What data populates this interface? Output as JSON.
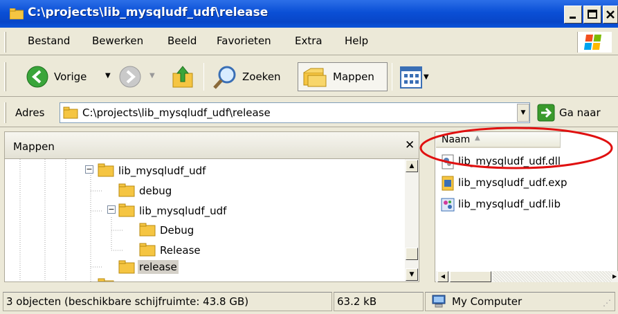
{
  "window": {
    "title": "C:\\projects\\lib_mysqludf_udf\\release"
  },
  "menu": [
    "Bestand",
    "Bewerken",
    "Beeld",
    "Favorieten",
    "Extra",
    "Help"
  ],
  "toolbar": {
    "back": "Vorige",
    "search": "Zoeken",
    "folders": "Mappen"
  },
  "address": {
    "label": "Adres",
    "value": "C:\\projects\\lib_mysqludf_udf\\release",
    "go": "Ga naar"
  },
  "folders_pane": {
    "title": "Mappen",
    "tree": [
      {
        "label": "lib_mysqludf_udf",
        "expander": "minus"
      },
      {
        "label": "debug"
      },
      {
        "label": "lib_mysqludf_udf",
        "expander": "minus"
      },
      {
        "label": "Debug"
      },
      {
        "label": "Release"
      },
      {
        "label": "release",
        "selected": true
      }
    ]
  },
  "files_pane": {
    "column_name": "Naam",
    "files": [
      {
        "name": "lib_mysqludf_udf.dll",
        "icon": "dll-icon"
      },
      {
        "name": "lib_mysqludf_udf.exp",
        "icon": "exp-icon"
      },
      {
        "name": "lib_mysqludf_udf.lib",
        "icon": "lib-icon"
      }
    ]
  },
  "status": {
    "objects": "3 objecten (beschikbare schijfruimte: 43.8 GB)",
    "size": "63.2 kB",
    "location": "My Computer"
  },
  "colors": {
    "titlebar": "#0a4fd6",
    "folder": "#f5c542",
    "go_green": "#3a9a2c",
    "annotation": "#e01010"
  }
}
